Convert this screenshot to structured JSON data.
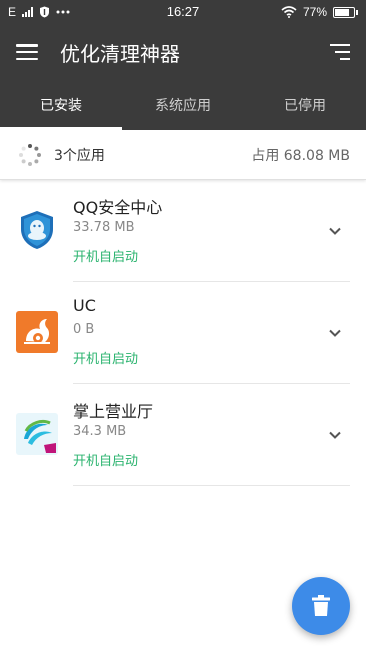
{
  "status_bar": {
    "time": "16:27",
    "network_label": "E",
    "battery_percent": "77%",
    "battery_level": 0.77
  },
  "app_bar": {
    "title": "优化清理神器",
    "menu_icon": "hamburger-menu-icon",
    "sort_icon": "sort-icon"
  },
  "tabs": [
    {
      "label": "已安装",
      "active": true
    },
    {
      "label": "系统应用",
      "active": false
    },
    {
      "label": "已停用",
      "active": false
    }
  ],
  "summary": {
    "count_text": "3个应用",
    "size_text": "占用 68.08 MB"
  },
  "apps": [
    {
      "name": "QQ安全中心",
      "size": "33.78 MB",
      "autostart": "开机自启动",
      "icon": "qq-security-center-icon"
    },
    {
      "name": "UC",
      "size": "0 B",
      "autostart": "开机自启动",
      "icon": "uc-browser-icon"
    },
    {
      "name": "掌上营业厅",
      "size": "34.3 MB",
      "autostart": "开机自启动",
      "icon": "china-mobile-icon"
    }
  ],
  "colors": {
    "toolbar": "#3b3b3b",
    "accent_green": "#2ab36e",
    "fab_blue": "#3d8be8"
  },
  "fab": {
    "icon": "trash-icon"
  }
}
